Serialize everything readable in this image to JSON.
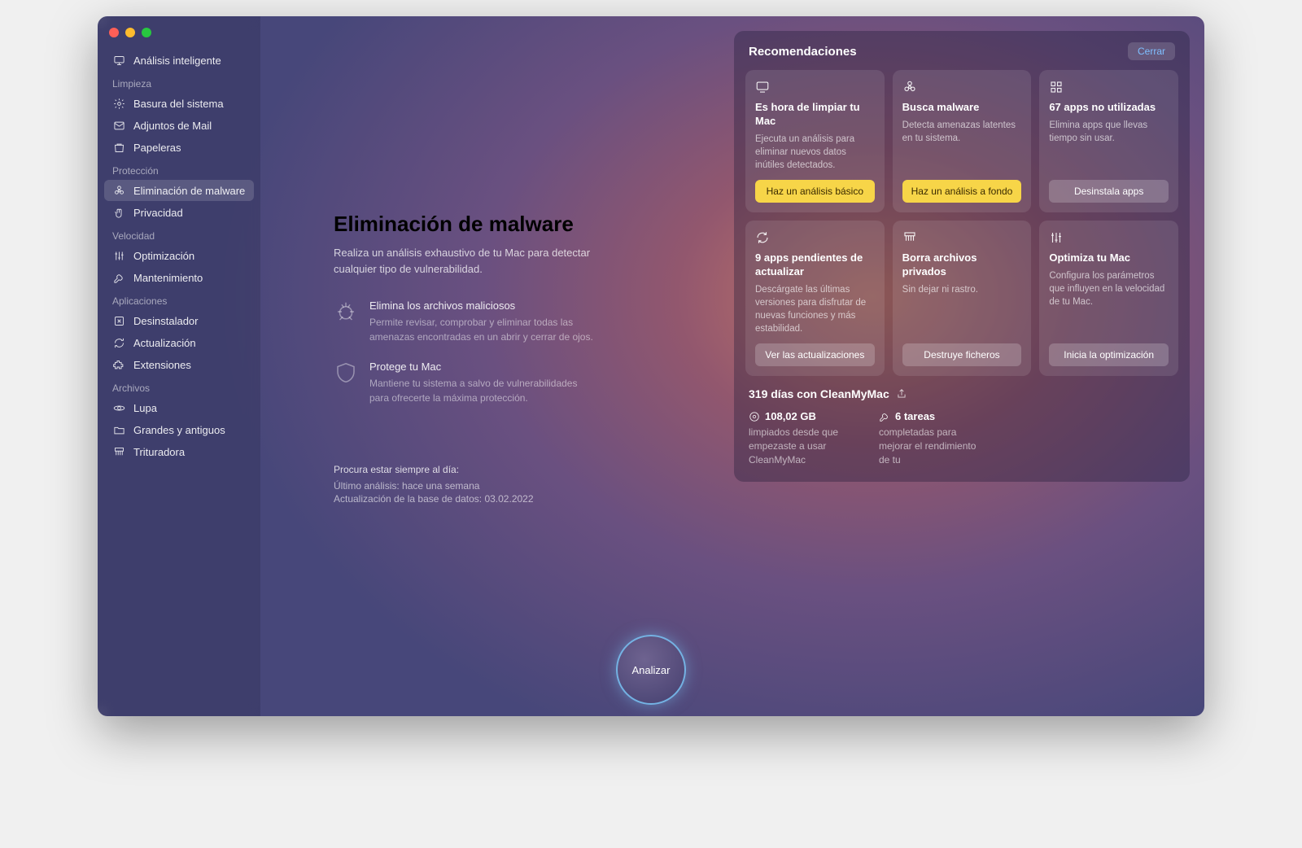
{
  "sidebar": {
    "smart_scan": "Análisis inteligente",
    "sections": {
      "cleanup": {
        "label": "Limpieza",
        "items": [
          "Basura del sistema",
          "Adjuntos de Mail",
          "Papeleras"
        ]
      },
      "protection": {
        "label": "Protección",
        "items": [
          "Eliminación de malware",
          "Privacidad"
        ]
      },
      "speed": {
        "label": "Velocidad",
        "items": [
          "Optimización",
          "Mantenimiento"
        ]
      },
      "apps": {
        "label": "Aplicaciones",
        "items": [
          "Desinstalador",
          "Actualización",
          "Extensiones"
        ]
      },
      "files": {
        "label": "Archivos",
        "items": [
          "Lupa",
          "Grandes y antiguos",
          "Trituradora"
        ]
      }
    }
  },
  "main": {
    "title": "Eliminación de malware",
    "subtitle": "Realiza un análisis exhaustivo de tu Mac para detectar cualquier tipo de vulnerabilidad.",
    "features": [
      {
        "title": "Elimina los archivos maliciosos",
        "desc": "Permite revisar, comprobar y eliminar todas las amenazas encontradas en un abrir y cerrar de ojos."
      },
      {
        "title": "Protege tu Mac",
        "desc": "Mantiene tu sistema a salvo de vulnerabilidades para ofrecerte la máxima protección."
      }
    ],
    "meta": {
      "hdr": "Procura estar siempre al día:",
      "last_scan": "Último análisis: hace una semana",
      "db": "Actualización de la base de datos: 03.02.2022"
    }
  },
  "panel": {
    "title": "Recomendaciones",
    "close": "Cerrar",
    "cards": [
      {
        "title": "Es hora de limpiar tu Mac",
        "desc": "Ejecuta un análisis para eliminar nuevos datos inútiles detectados.",
        "btn": "Haz un análisis básico",
        "style": "yellow"
      },
      {
        "title": "Busca malware",
        "desc": "Detecta amenazas latentes en tu sistema.",
        "btn": "Haz un análisis a fondo",
        "style": "yellow"
      },
      {
        "title": "67 apps no utilizadas",
        "desc": "Elimina apps que llevas tiempo sin usar.",
        "btn": "Desinstala apps",
        "style": "grey"
      },
      {
        "title": "9 apps pendientes de actualizar",
        "desc": "Descárgate las últimas versiones para disfrutar de nuevas funciones y más estabilidad.",
        "btn": "Ver las actualizaciones",
        "style": "grey"
      },
      {
        "title": "Borra archivos privados",
        "desc": "Sin dejar ni rastro.",
        "btn": "Destruye ficheros",
        "style": "grey"
      },
      {
        "title": "Optimiza tu Mac",
        "desc": "Configura los parámetros que influyen en la velocidad de tu Mac.",
        "btn": "Inicia la optimización",
        "style": "grey"
      }
    ],
    "stats": {
      "header": "319 días con CleanMyMac",
      "cleaned": {
        "value": "108,02 GB",
        "desc": "limpiados desde que empezaste a usar CleanMyMac"
      },
      "tasks": {
        "value": "6 tareas",
        "desc": "completadas para mejorar el rendimiento de tu"
      }
    }
  },
  "analyze": "Analizar"
}
